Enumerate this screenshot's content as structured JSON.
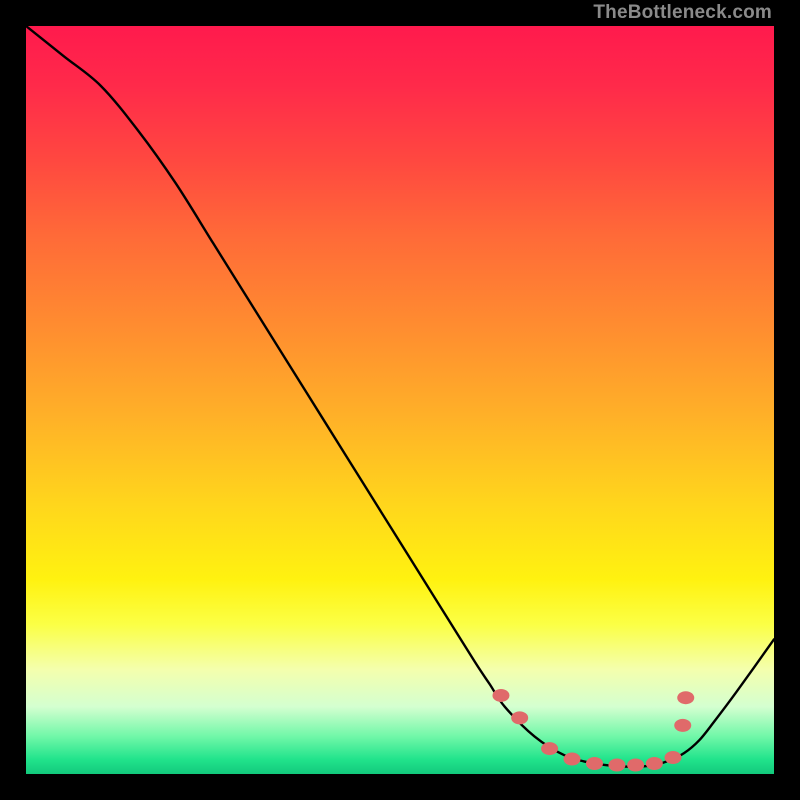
{
  "watermark": "TheBottleneck.com",
  "chart_data": {
    "type": "line",
    "title": "",
    "xlabel": "",
    "ylabel": "",
    "xlim": [
      0,
      100
    ],
    "ylim": [
      0,
      100
    ],
    "series": [
      {
        "name": "bottleneck-curve",
        "x": [
          0,
          5,
          10,
          15,
          20,
          25,
          30,
          35,
          40,
          45,
          50,
          55,
          60,
          62,
          64,
          68,
          72,
          76,
          80,
          82,
          84,
          86,
          88,
          90,
          92,
          95,
          100
        ],
        "y": [
          100,
          96,
          92,
          86,
          79,
          71,
          63,
          55,
          47,
          39,
          31,
          23,
          15,
          12,
          9,
          5,
          2.5,
          1.4,
          1.0,
          1.0,
          1.2,
          1.8,
          2.8,
          4.5,
          7,
          11,
          18
        ]
      }
    ],
    "markers": {
      "name": "highlight-dots",
      "x": [
        63.5,
        66,
        70,
        73,
        76,
        79,
        81.5,
        84,
        86.5,
        87.8,
        88.2
      ],
      "y": [
        10.5,
        7.5,
        3.4,
        2.0,
        1.4,
        1.2,
        1.2,
        1.4,
        2.2,
        6.5,
        10.2
      ]
    }
  },
  "colors": {
    "curve": "#000000",
    "dots": "#e06a6a",
    "frame": "#000000"
  }
}
